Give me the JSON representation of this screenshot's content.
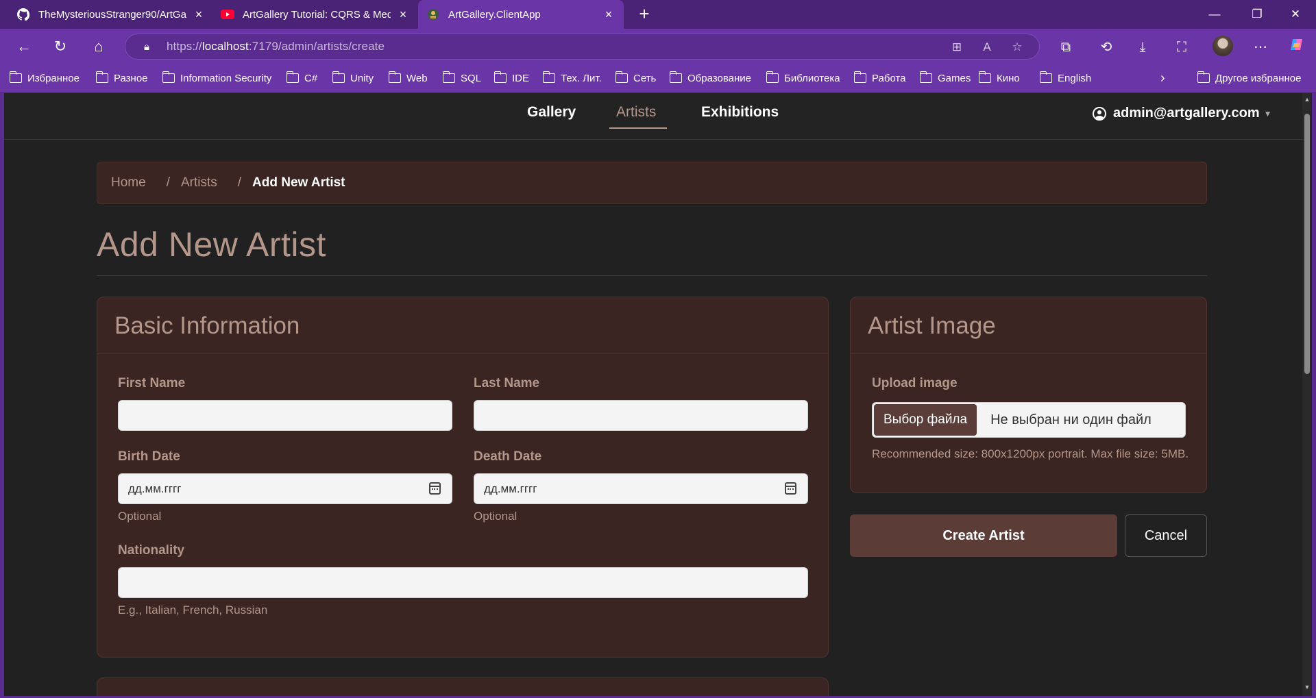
{
  "browser": {
    "tabs": [
      {
        "title": "TheMysteriousStranger90/ArtGallery",
        "favicon": "github-icon"
      },
      {
        "title": "ArtGallery Tutorial: CQRS & Mediator",
        "favicon": "youtube-icon"
      },
      {
        "title": "ArtGallery.ClientApp",
        "favicon": "app-icon",
        "active": true
      }
    ],
    "url_prefix": "https://",
    "url_host": "localhost",
    "url_path": ":7179/admin/artists/create",
    "bookmarks": [
      "Избранное",
      "Разное",
      "Information Security",
      "C#",
      "Unity",
      "Web",
      "SQL",
      "IDE",
      "Тех. Лит.",
      "Сеть",
      "Образование",
      "Библиотека",
      "Работа",
      "Games",
      "Кино",
      "English"
    ],
    "other_bookmarks": "Другое избранное",
    "accent_color": "#6a35a6"
  },
  "nav": {
    "links": [
      "Gallery",
      "Artists",
      "Exhibitions"
    ],
    "active": "Artists",
    "user": "admin@artgallery.com"
  },
  "breadcrumb": {
    "home": "Home",
    "artists": "Artists",
    "current": "Add New Artist"
  },
  "page": {
    "title": "Add New Artist"
  },
  "basic_info": {
    "heading": "Basic Information",
    "first_name_label": "First Name",
    "first_name_value": "",
    "last_name_label": "Last Name",
    "last_name_value": "",
    "birth_date_label": "Birth Date",
    "birth_date_placeholder": "дд.мм.гггг",
    "birth_date_help": "Optional",
    "death_date_label": "Death Date",
    "death_date_placeholder": "дд.мм.гггг",
    "death_date_help": "Optional",
    "nationality_label": "Nationality",
    "nationality_value": "",
    "nationality_help": "E.g., Italian, French, Russian"
  },
  "artist_image": {
    "heading": "Artist Image",
    "upload_label": "Upload image",
    "choose_button": "Выбор файла",
    "no_file_text": "Не выбран ни один файл",
    "help": "Recommended size: 800x1200px portrait. Max file size: 5MB."
  },
  "actions": {
    "create": "Create Artist",
    "cancel": "Cancel"
  },
  "theme": {
    "background": "#212121",
    "card": "#3b2523",
    "accent_text": "#b4978a",
    "primary_button": "#5c3c37"
  }
}
